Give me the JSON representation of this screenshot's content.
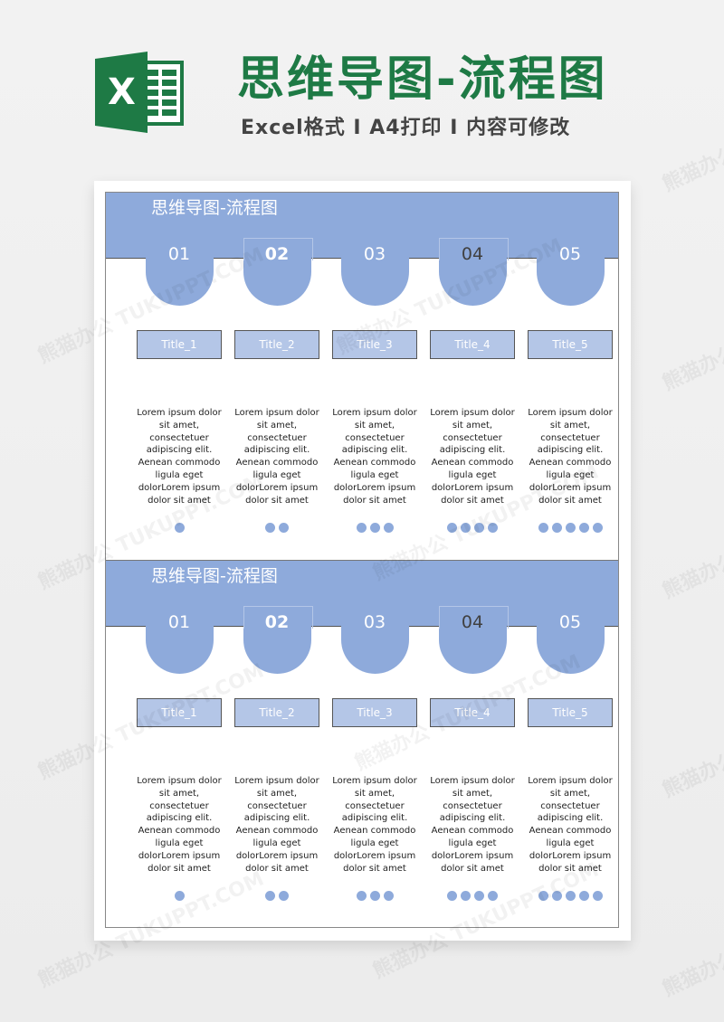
{
  "header": {
    "logo_icon": "excel-icon",
    "logo_letter": "X",
    "title": "思维导图-流程图",
    "subtitle": "Excel格式 I A4打印 I 内容可修改",
    "title_color": "#1e7a45",
    "accent_color": "#8eaadb",
    "title_box_color": "#b4c6e7"
  },
  "sections": [
    {
      "band_title": "思维导图-流程图",
      "steps": [
        {
          "number": "01",
          "title": "Title_1",
          "desc": [
            "Lorem ipsum dolor",
            "sit amet,",
            "consectetuer",
            "adipiscing elit.",
            "Aenean commodo",
            "ligula eget",
            "dolorLorem ipsum",
            "dolor sit amet"
          ],
          "dots": 1
        },
        {
          "number": "02",
          "title": "Title_2",
          "desc": [
            "Lorem ipsum dolor",
            "sit amet,",
            "consectetuer",
            "adipiscing elit.",
            "Aenean commodo",
            "ligula eget",
            "dolorLorem ipsum",
            "dolor sit amet"
          ],
          "dots": 2
        },
        {
          "number": "03",
          "title": "Title_3",
          "desc": [
            "Lorem ipsum dolor",
            "sit amet,",
            "consectetuer",
            "adipiscing elit.",
            "Aenean commodo",
            "ligula eget",
            "dolorLorem ipsum",
            "dolor sit amet"
          ],
          "dots": 3
        },
        {
          "number": "04",
          "title": "Title_4",
          "desc": [
            "Lorem ipsum dolor",
            "sit amet,",
            "consectetuer",
            "adipiscing elit.",
            "Aenean commodo",
            "ligula eget",
            "dolorLorem ipsum",
            "dolor sit amet"
          ],
          "dots": 4
        },
        {
          "number": "05",
          "title": "Title_5",
          "desc": [
            "Lorem ipsum dolor",
            "sit amet,",
            "consectetuer",
            "adipiscing elit.",
            "Aenean commodo",
            "ligula eget",
            "dolorLorem ipsum",
            "dolor sit amet"
          ],
          "dots": 5
        }
      ]
    },
    {
      "band_title": "思维导图-流程图",
      "steps": [
        {
          "number": "01",
          "title": "Title_1",
          "desc": [
            "Lorem ipsum dolor",
            "sit amet,",
            "consectetuer",
            "adipiscing elit.",
            "Aenean commodo",
            "ligula eget",
            "dolorLorem ipsum",
            "dolor sit amet"
          ],
          "dots": 1
        },
        {
          "number": "02",
          "title": "Title_2",
          "desc": [
            "Lorem ipsum dolor",
            "sit amet,",
            "consectetuer",
            "adipiscing elit.",
            "Aenean commodo",
            "ligula eget",
            "dolorLorem ipsum",
            "dolor sit amet"
          ],
          "dots": 2
        },
        {
          "number": "03",
          "title": "Title_3",
          "desc": [
            "Lorem ipsum dolor",
            "sit amet,",
            "consectetuer",
            "adipiscing elit.",
            "Aenean commodo",
            "ligula eget",
            "dolorLorem ipsum",
            "dolor sit amet"
          ],
          "dots": 3
        },
        {
          "number": "04",
          "title": "Title_4",
          "desc": [
            "Lorem ipsum dolor",
            "sit amet,",
            "consectetuer",
            "adipiscing elit.",
            "Aenean commodo",
            "ligula eget",
            "dolorLorem ipsum",
            "dolor sit amet"
          ],
          "dots": 4
        },
        {
          "number": "05",
          "title": "Title_5",
          "desc": [
            "Lorem ipsum dolor",
            "sit amet,",
            "consectetuer",
            "adipiscing elit.",
            "Aenean commodo",
            "ligula eget",
            "dolorLorem ipsum",
            "dolor sit amet"
          ],
          "dots": 5
        }
      ]
    }
  ],
  "watermarks": [
    "熊猫办公 TUKUPPT.COM"
  ]
}
